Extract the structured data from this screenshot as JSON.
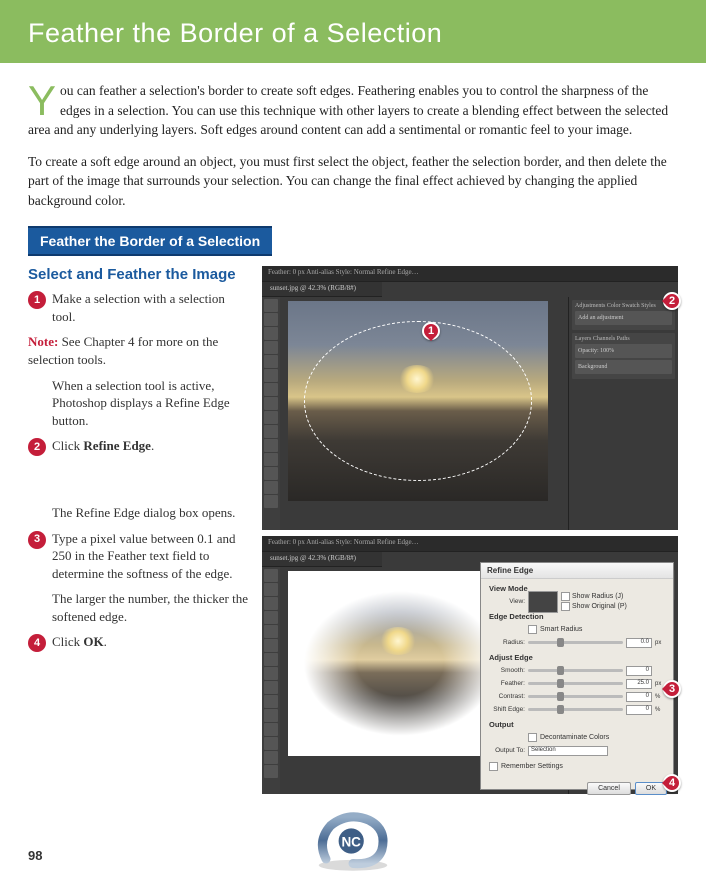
{
  "page": {
    "title": "Feather the Border of a Selection",
    "page_number": "98"
  },
  "intro": {
    "dropcap": "Y",
    "p1_rest": "ou can feather a selection's border to create soft edges. Feathering enables you to control the sharpness of the edges in a selection. You can use this technique with other layers to create a blending effect between the selected area and any underlying layers. Soft edges around content can add a sentimental or romantic feel to your image.",
    "p2": "To create a soft edge around an object, you must first select the object, feather the selection border, and then delete the part of the image that surrounds your selection. You can change the final effect achieved by changing the applied background color."
  },
  "section_label": "Feather the Border of a Selection",
  "left": {
    "subhead": "Select and Feather the Image",
    "steps": [
      {
        "n": "1",
        "text": "Make a selection with a selection tool."
      },
      {
        "n": "2",
        "html": "Click <b>Refine Edge</b>."
      },
      {
        "n": "3",
        "text": "Type a pixel value between 0.1 and 250 in the Feather text field to determine the softness of the edge."
      },
      {
        "n": "4",
        "html": "Click <b>OK</b>."
      }
    ],
    "note_label": "Note:",
    "note_text": " See Chapter 4 for more on the selection tools.",
    "info1": "When a selection tool is active, Photoshop displays a Refine Edge button.",
    "info2": "The Refine Edge dialog box opens.",
    "info3": "The larger the number, the thicker the softened edge."
  },
  "screenshot": {
    "tab_label": "sunset.jpg @ 42.3% (RGB/8#)",
    "toolbar_items": "Feather: 0 px   Anti-alias   Style: Normal   Refine Edge…",
    "panels": {
      "adjustments_head": "Adjustments  Color  Swatch  Styles",
      "adjustments_btn": "Add an adjustment",
      "layers_head": "Layers  Channels  Paths",
      "layer_bg": "Background",
      "opacity": "Opacity: 100%"
    }
  },
  "dialog": {
    "title": "Refine Edge",
    "sections": {
      "view_mode": "View Mode",
      "view_label": "View:",
      "show_radius": "Show Radius (J)",
      "show_original": "Show Original (P)",
      "edge_detection": "Edge Detection",
      "smart_radius": "Smart Radius",
      "radius_label": "Radius:",
      "radius_val": "0.0",
      "radius_unit": "px",
      "adjust_edge": "Adjust Edge",
      "smooth_label": "Smooth:",
      "smooth_val": "0",
      "feather_label": "Feather:",
      "feather_val": "25.0",
      "feather_unit": "px",
      "contrast_label": "Contrast:",
      "contrast_val": "0",
      "contrast_unit": "%",
      "shift_label": "Shift Edge:",
      "shift_val": "0",
      "shift_unit": "%",
      "output": "Output",
      "decontaminate": "Decontaminate Colors",
      "output_to_label": "Output To:",
      "output_to_val": "Selection",
      "remember": "Remember Settings"
    },
    "buttons": {
      "cancel": "Cancel",
      "ok": "OK"
    }
  },
  "callouts": {
    "c1": "1",
    "c2": "2",
    "c3": "3",
    "c4": "4"
  }
}
